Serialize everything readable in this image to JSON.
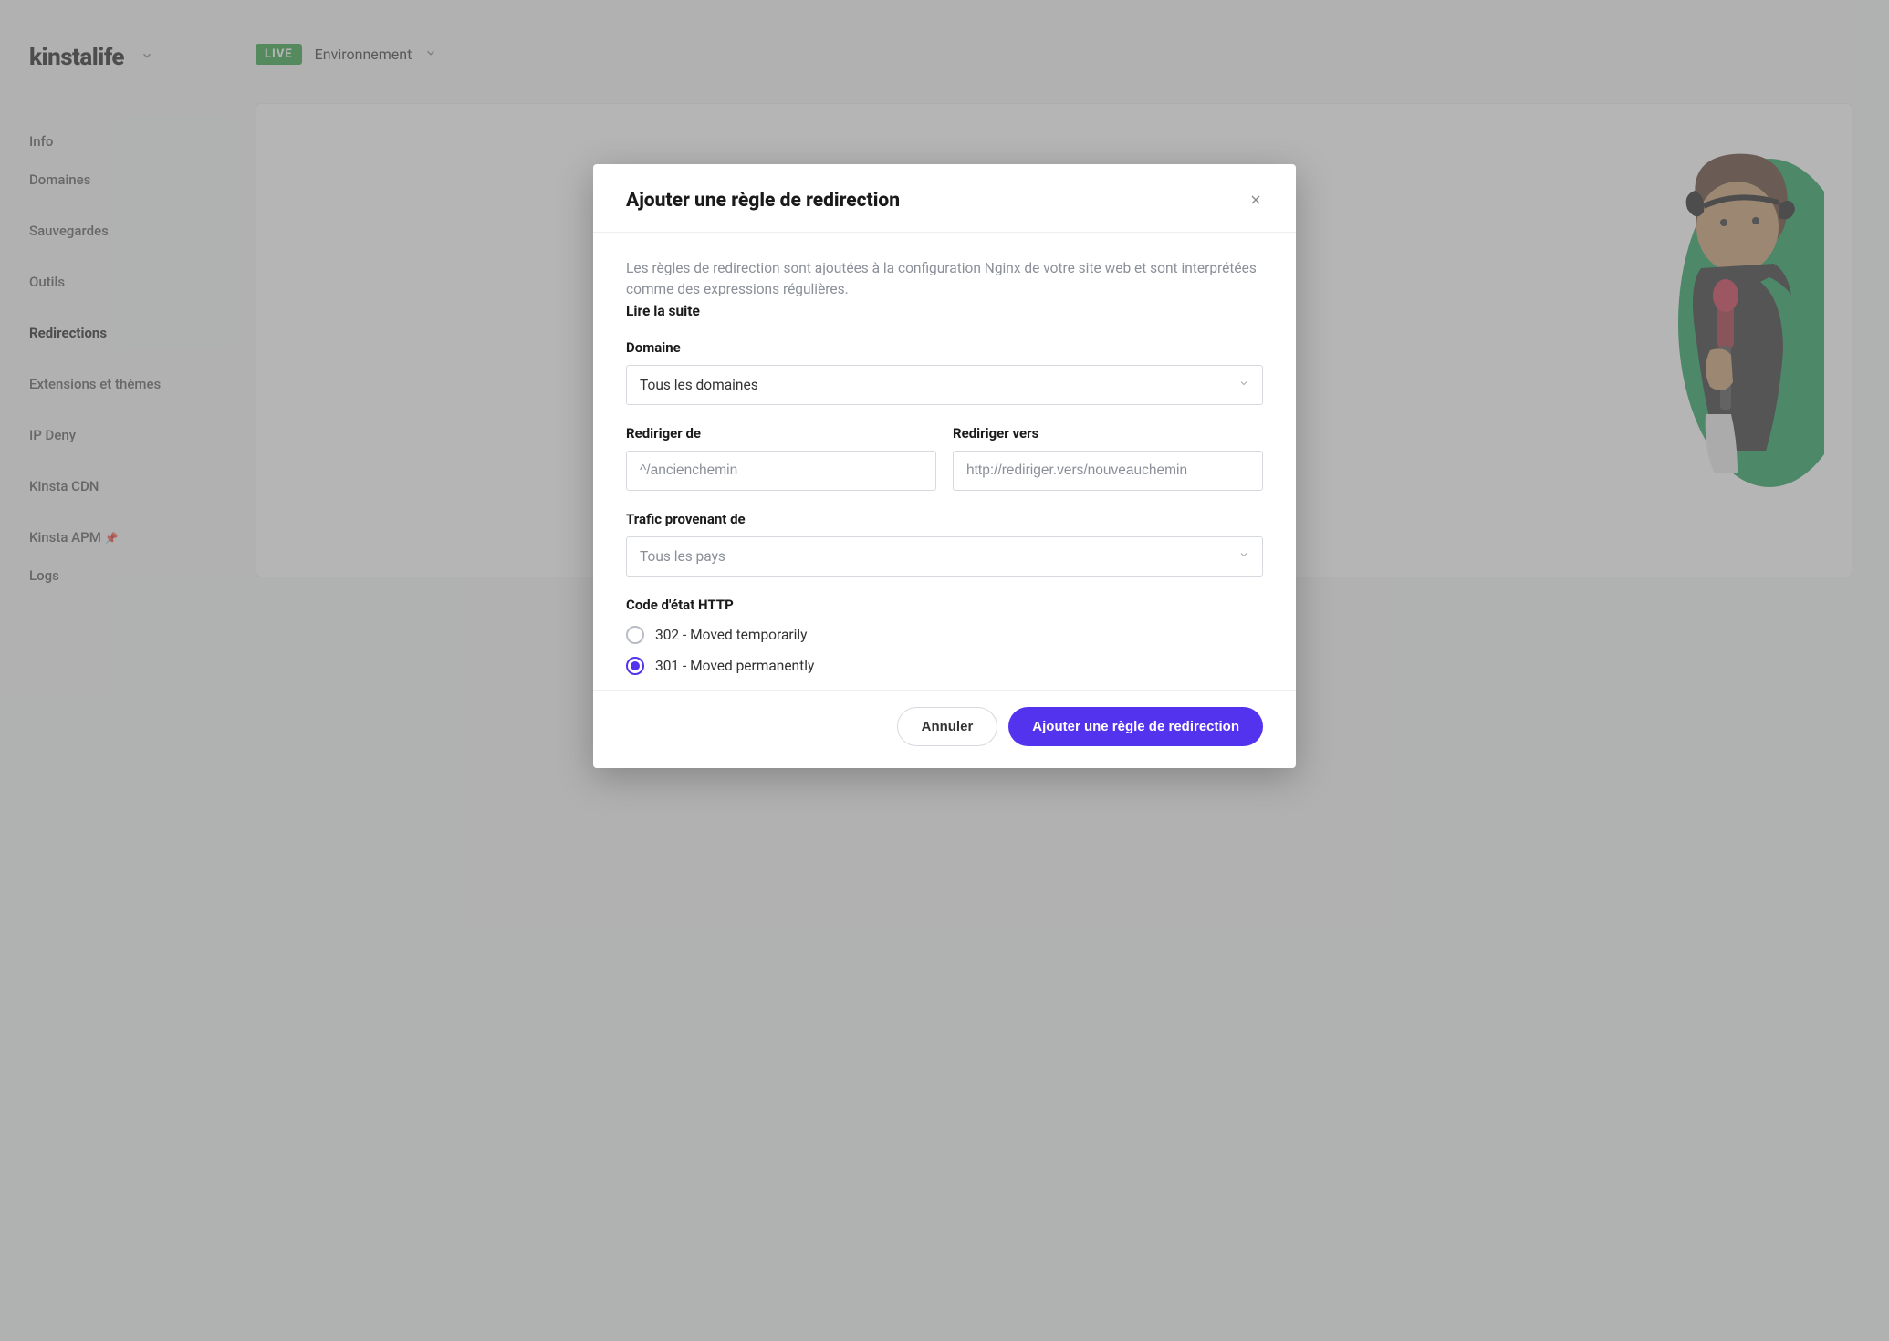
{
  "site_name": "kinstalife",
  "env": {
    "badge": "LIVE",
    "label": "Environnement"
  },
  "sidebar": {
    "items": [
      {
        "label": "Info"
      },
      {
        "label": "Domaines"
      },
      {
        "label": "Sauvegardes"
      },
      {
        "label": "Outils"
      },
      {
        "label": "Redirections",
        "active": true
      },
      {
        "label": "Extensions et thèmes"
      },
      {
        "label": "IP Deny"
      },
      {
        "label": "Kinsta CDN"
      },
      {
        "label": "Kinsta APM",
        "pin": true
      },
      {
        "label": "Logs"
      }
    ]
  },
  "modal": {
    "title": "Ajouter une règle de redirection",
    "description": "Les règles de redirection sont ajoutées à la configuration Nginx de votre site web et sont interprétées comme des expressions régulières.",
    "read_more": "Lire la suite",
    "domain": {
      "label": "Domaine",
      "value": "Tous les domaines"
    },
    "redirect_from": {
      "label": "Rediriger de",
      "placeholder": "^/ancienchemin"
    },
    "redirect_to": {
      "label": "Rediriger vers",
      "placeholder": "http://rediriger.vers/nouveauchemin"
    },
    "traffic_from": {
      "label": "Trafic provenant de",
      "placeholder": "Tous les pays"
    },
    "status": {
      "label": "Code d'état HTTP",
      "opt302": "302 - Moved temporarily",
      "opt301": "301 - Moved permanently",
      "selected": "301"
    },
    "cancel": "Annuler",
    "submit": "Ajouter une règle de redirection"
  }
}
